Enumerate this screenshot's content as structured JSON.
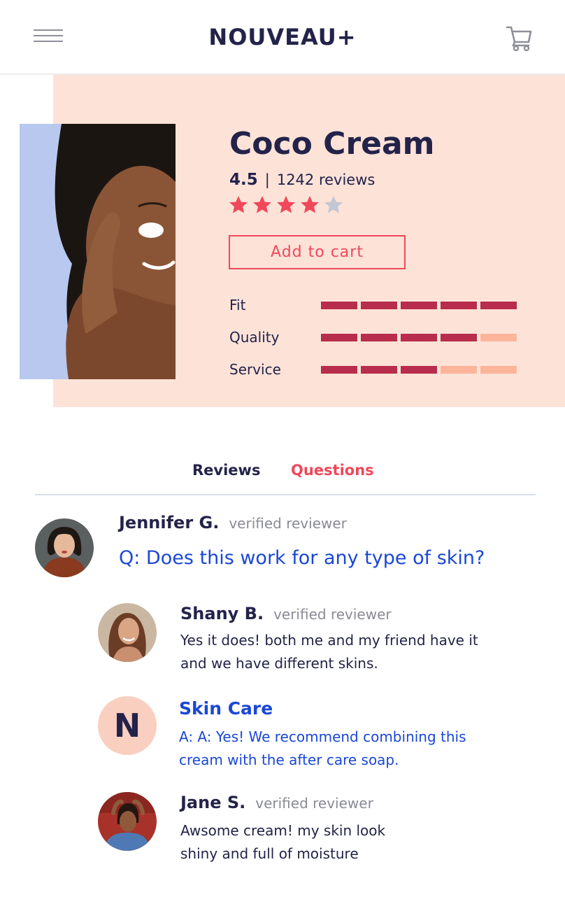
{
  "header": {
    "brand": "NOUVEAU+",
    "menu_icon": "hamburger-menu-icon",
    "cart_icon": "shopping-cart-icon"
  },
  "product": {
    "title": "Coco Cream",
    "rating": "4.5",
    "separator": "|",
    "reviews_count": "1242 reviews",
    "stars": 4,
    "max_stars": 5,
    "add_to_cart": "Add to cart",
    "metrics": [
      {
        "label": "Fit",
        "score": 5,
        "max": 5
      },
      {
        "label": "Quality",
        "score": 4,
        "max": 5
      },
      {
        "label": "Service",
        "score": 3,
        "max": 5
      }
    ]
  },
  "tabs": {
    "reviews": "Reviews",
    "questions": "Questions",
    "active": "Questions"
  },
  "thread": {
    "question": {
      "name": "Jennifer G.",
      "badge": "verified reviewer",
      "text": "Q: Does this work for any type of skin?"
    },
    "answers": [
      {
        "name": "Shany B.",
        "badge": "verified reviewer",
        "line1": "Yes it does! both me and my friend have it",
        "line2": "and we have different skins."
      },
      {
        "name": "Skin Care",
        "initial": "N",
        "line1": "A: A: Yes! We recommend combining this",
        "line2": "cream with the after care soap."
      },
      {
        "name": "Jane S.",
        "badge": "verified reviewer",
        "line1": "Awsome cream! my skin look",
        "line2": "shiny and full of moisture"
      }
    ]
  },
  "colors": {
    "accent": "#f0485a",
    "navy": "#23234a",
    "link_blue": "#1a47d6",
    "hero_bg": "#fde2d8",
    "bar_filled": "#b72d4b",
    "bar_empty": "#fcb59a",
    "star_filled": "#f0485a",
    "star_empty": "#c3c6d4"
  }
}
